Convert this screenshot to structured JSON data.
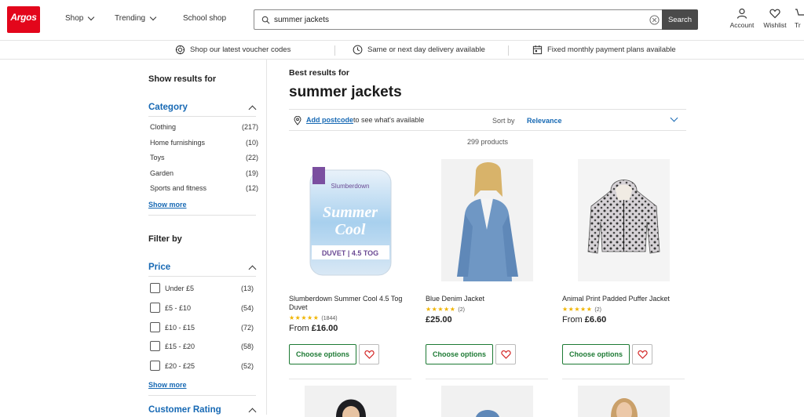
{
  "header": {
    "logo": "Argos",
    "nav": [
      "Shop",
      "Trending",
      "School shop"
    ],
    "search": {
      "value": "summer jackets",
      "button": "Search"
    },
    "icons": [
      {
        "label": "Account",
        "icon": "account-icon"
      },
      {
        "label": "Wishlist",
        "icon": "heart-icon"
      },
      {
        "label": "Tr",
        "icon": "trolley-icon"
      }
    ]
  },
  "strip": [
    {
      "text": "Shop our latest voucher codes",
      "icon": "voucher-icon"
    },
    {
      "text": "Same or next day delivery available",
      "icon": "clock-icon"
    },
    {
      "text": "Fixed monthly payment plans available",
      "icon": "calendar-icon"
    }
  ],
  "sidebar": {
    "show_results": "Show results for",
    "category": {
      "title": "Category",
      "items": [
        {
          "label": "Clothing",
          "count": "(217)"
        },
        {
          "label": "Home furnishings",
          "count": "(10)"
        },
        {
          "label": "Toys",
          "count": "(22)"
        },
        {
          "label": "Garden",
          "count": "(19)"
        },
        {
          "label": "Sports and fitness",
          "count": "(12)"
        }
      ],
      "show_more": "Show more"
    },
    "filter_by": "Filter by",
    "price": {
      "title": "Price",
      "items": [
        {
          "label": "Under £5",
          "count": "(13)"
        },
        {
          "label": "£5 - £10",
          "count": "(54)"
        },
        {
          "label": "£10 - £15",
          "count": "(72)"
        },
        {
          "label": "£15 - £20",
          "count": "(58)"
        },
        {
          "label": "£20 - £25",
          "count": "(52)"
        }
      ],
      "show_more": "Show more"
    },
    "customer_rating": "Customer Rating"
  },
  "main": {
    "best_for": "Best results for",
    "query": "summer jackets",
    "postcode_link": "Add postcode",
    "postcode_rest": "to see what's available",
    "sort_label": "Sort by",
    "sort_value": "Relevance",
    "count": "299 products",
    "products": [
      {
        "name": "Slumberdown Summer Cool 4.5 Tog Duvet",
        "rating": 4.5,
        "reviews": "(1844)",
        "price_prefix": "From",
        "price": "£16.00",
        "button": "Choose options",
        "image_text": [
          "Slumberdown",
          "Summer",
          "Cool",
          "DUVET | 4.5 TOG"
        ]
      },
      {
        "name": "Blue Denim Jacket",
        "rating": 5,
        "reviews": "(2)",
        "price_prefix": "",
        "price": "£25.00",
        "button": "Choose options"
      },
      {
        "name": "Animal Print Padded Puffer Jacket",
        "rating": 4.5,
        "reviews": "(2)",
        "price_prefix": "From",
        "price": "£6.60",
        "button": "Choose options"
      }
    ]
  }
}
